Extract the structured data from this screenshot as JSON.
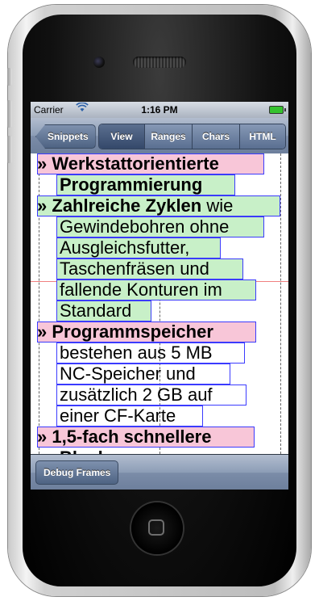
{
  "status_bar": {
    "carrier": "Carrier",
    "wifi_icon": "wifi-icon",
    "time": "1:16 PM",
    "battery_icon": "battery-icon"
  },
  "nav": {
    "back_label": "Snippets",
    "tabs": [
      {
        "label": "View",
        "active": true
      },
      {
        "label": "Ranges",
        "active": false
      },
      {
        "label": "Chars",
        "active": false
      },
      {
        "label": "HTML",
        "active": false
      }
    ]
  },
  "content": {
    "bullet": "»",
    "lines": [
      {
        "parts": [
          {
            "text": "Werkstattorientierte",
            "bold": true
          }
        ]
      },
      {
        "parts": [
          {
            "text": "Programmierung",
            "bold": true
          }
        ]
      },
      {
        "parts": [
          {
            "text": "Zahlreiche Zyklen",
            "bold": true
          },
          {
            "text": " wie",
            "bold": false
          }
        ]
      },
      {
        "parts": [
          {
            "text": "Gewindebohren ohne",
            "bold": false
          }
        ]
      },
      {
        "parts": [
          {
            "text": "Ausgleichsfutter,",
            "bold": false
          }
        ]
      },
      {
        "parts": [
          {
            "text": "Taschenfräsen und",
            "bold": false
          }
        ]
      },
      {
        "parts": [
          {
            "text": "fallende Konturen im",
            "bold": false
          }
        ]
      },
      {
        "parts": [
          {
            "text": "Standard",
            "bold": false
          }
        ]
      },
      {
        "parts": [
          {
            "text": "Programmspeicher",
            "bold": true
          }
        ]
      },
      {
        "parts": [
          {
            "text": "bestehen aus 5 MB",
            "bold": false
          }
        ]
      },
      {
        "parts": [
          {
            "text": "NC-Speicher und",
            "bold": false
          }
        ]
      },
      {
        "parts": [
          {
            "text": "zusätzlich 2 GB auf",
            "bold": false
          }
        ]
      },
      {
        "parts": [
          {
            "text": "einer CF-Karte",
            "bold": false
          }
        ]
      },
      {
        "parts": [
          {
            "text": "1,5-fach schnellere",
            "bold": true
          }
        ]
      },
      {
        "parts": [
          {
            "text": "Block-",
            "bold": true
          }
        ]
      }
    ]
  },
  "toolbar": {
    "debug_label": "Debug Frames"
  }
}
